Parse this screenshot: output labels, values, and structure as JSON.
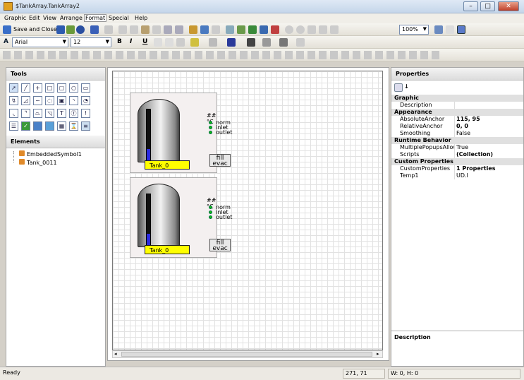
{
  "window": {
    "title": "$TankArray.TankArray2",
    "min": "–",
    "max": "□",
    "close": "✕"
  },
  "menu": [
    "Graphic",
    "Edit",
    "View",
    "Arrange",
    "Format",
    "Special",
    "Help"
  ],
  "toolbar": {
    "save_close_label": "Save and Close",
    "zoom_value": "100%",
    "font_name": "Arial",
    "font_size": "12",
    "bold": "B",
    "italic": "I",
    "underline": "U"
  },
  "tools_panel": {
    "title": "Tools"
  },
  "elements_panel": {
    "title": "Elements",
    "items": [
      "EmbeddedSymbol1",
      "Tank_0011"
    ]
  },
  "symbols": [
    {
      "temp": "## °C",
      "leds": [
        "norm",
        "inlet",
        "outlet"
      ],
      "label": "Tank_0",
      "button": [
        "fill",
        "evac"
      ],
      "level": 0.3
    },
    {
      "temp": "## °C",
      "leds": [
        "norm",
        "inlet",
        "outlet"
      ],
      "label": "Tank_0",
      "button": [
        "fill",
        "evac"
      ],
      "level": 0.3
    }
  ],
  "properties": {
    "title": "Properties",
    "categories": [
      {
        "name": "Graphic",
        "rows": [
          {
            "name": "Description",
            "value": ""
          }
        ]
      },
      {
        "name": "Appearance",
        "rows": [
          {
            "name": "AbsoluteAnchor",
            "value": "115, 95",
            "bold": true
          },
          {
            "name": "RelativeAnchor",
            "value": "0, 0",
            "bold": true
          },
          {
            "name": "Smoothing",
            "value": "False"
          }
        ]
      },
      {
        "name": "Runtime Behavior",
        "rows": [
          {
            "name": "MultiplePopupsAllowed",
            "value": "True"
          },
          {
            "name": "Scripts",
            "value": "(Collection)",
            "bold": true
          }
        ]
      },
      {
        "name": "Custom Properties",
        "rows": [
          {
            "name": "CustomProperties",
            "value": "1 Properties",
            "bold": true
          },
          {
            "name": "Temp1",
            "value": "UD.I"
          }
        ]
      }
    ],
    "description_title": "Description"
  },
  "status": {
    "text": "Ready",
    "coords": "271, 71",
    "size": "W: 0, H: 0"
  },
  "colors": {
    "tank_label_bg": "#ffff00",
    "level_fill": "#2a2ae0",
    "led": "#12c012"
  }
}
